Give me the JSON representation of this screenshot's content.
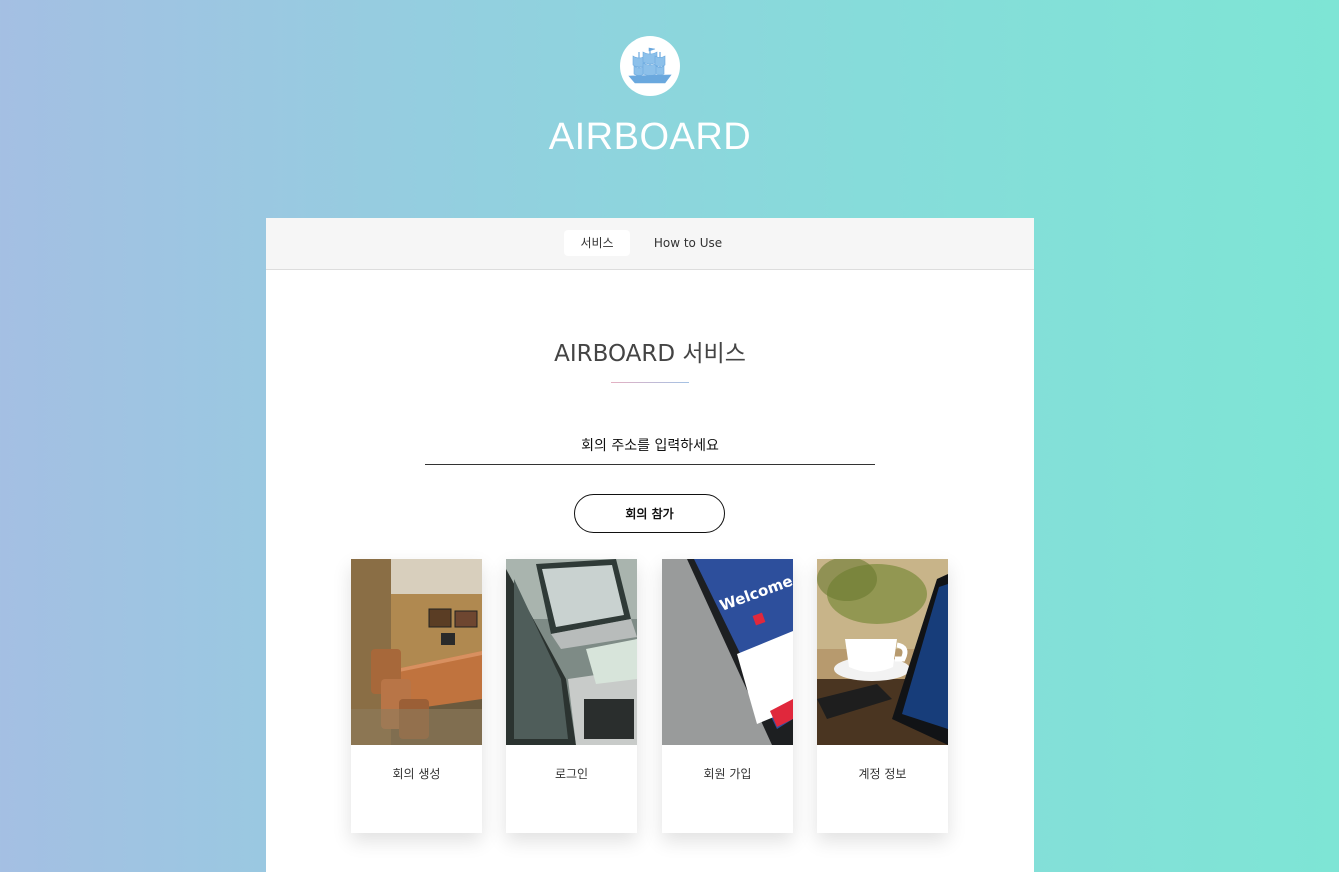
{
  "brand": {
    "title": "AIRBOARD"
  },
  "tabs": [
    {
      "label": "서비스",
      "active": true
    },
    {
      "label": "How to Use",
      "active": false
    }
  ],
  "main": {
    "section_title": "AIRBOARD 서비스",
    "address_input": {
      "placeholder": "회의 주소를 입력하세요",
      "value": ""
    },
    "join_button_label": "회의 참가"
  },
  "cards": [
    {
      "label": "회의 생성",
      "image": "conference-room-photo"
    },
    {
      "label": "로그인",
      "image": "laptop-photo"
    },
    {
      "label": "회원 가입",
      "image": "phone-welcome-photo"
    },
    {
      "label": "계정 정보",
      "image": "coffee-tablet-photo"
    }
  ],
  "colors": {
    "gradient_start": "#a4bfe3",
    "gradient_end": "#7ee5d5",
    "panel_bg": "#ffffff",
    "tabbar_bg": "#f6f6f6"
  },
  "icons": {
    "logo": "sailing-ship-icon"
  }
}
